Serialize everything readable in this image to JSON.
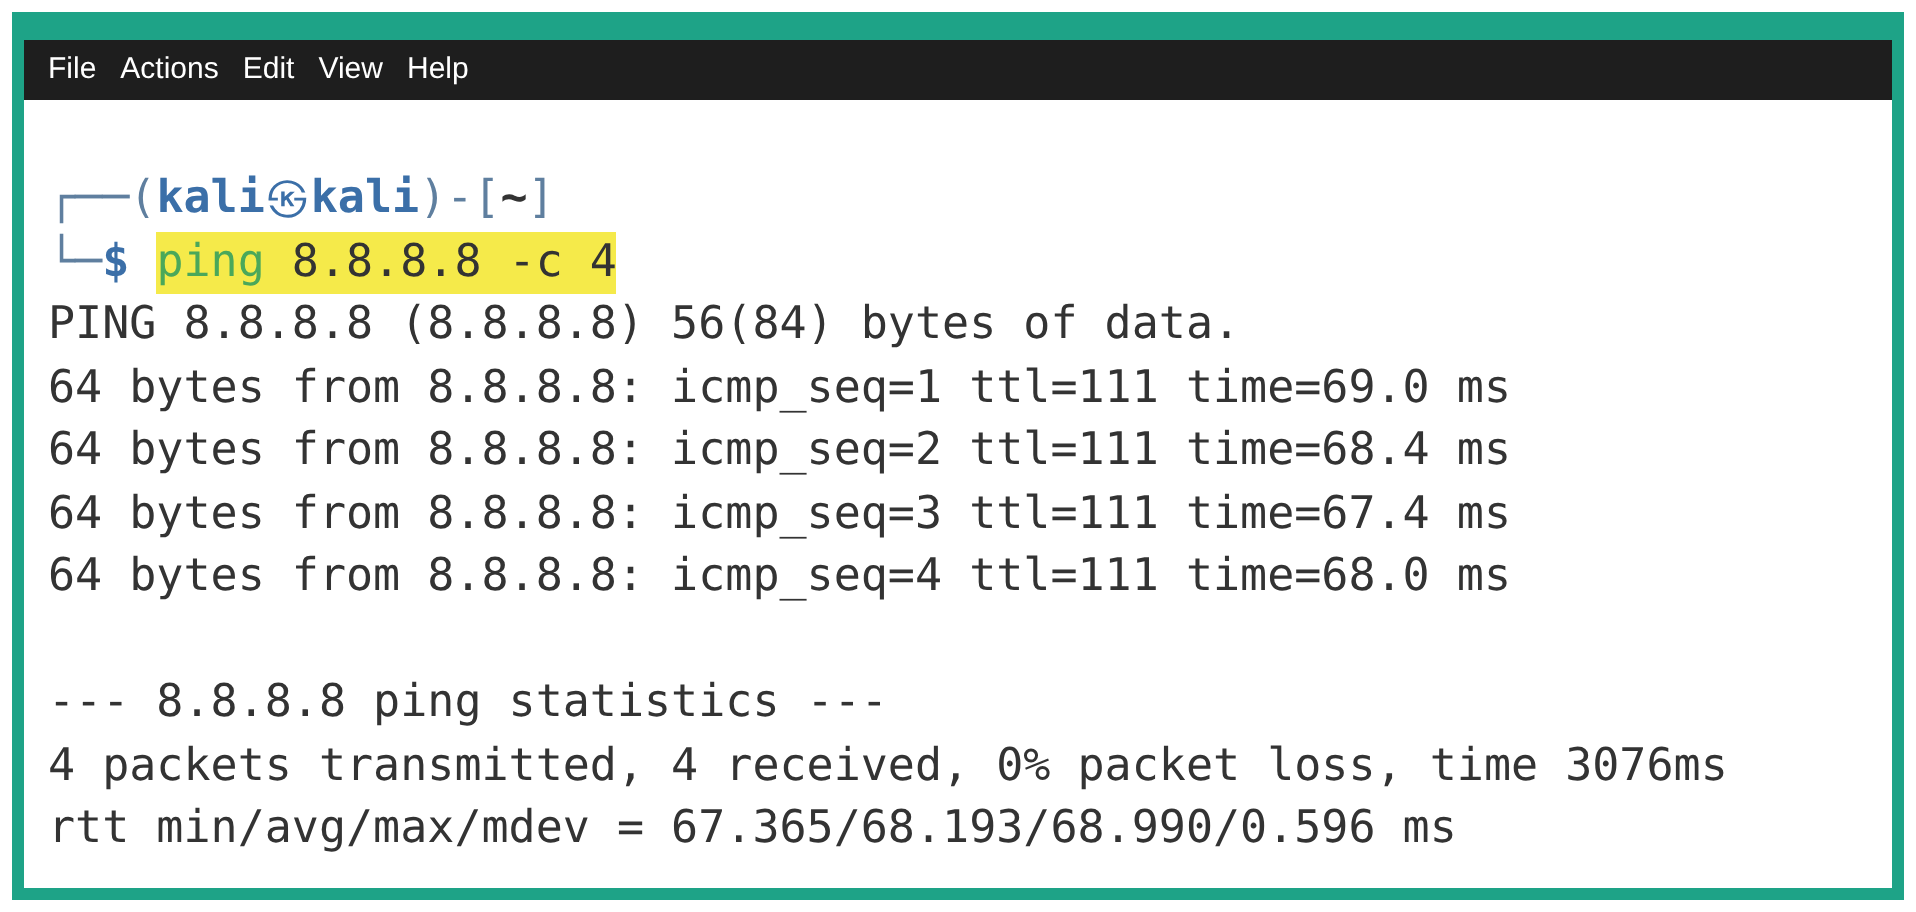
{
  "menu": [
    "File",
    "Actions",
    "Edit",
    "View",
    "Help"
  ],
  "prompt": {
    "open": "┌──(",
    "user": "kali",
    "at": "㉿",
    "host": "kali",
    "mid": ")-[",
    "path": "~",
    "close": "]",
    "corner": "└─",
    "symbol": "$"
  },
  "command": {
    "program": "ping",
    "args": "8.8.8.8 -c 4",
    "highlighted": true
  },
  "output": [
    {
      "lines": [
        "PING 8.8.8.8 (8.8.8.8) 56(84) bytes of data.",
        "64 bytes from 8.8.8.8: icmp_seq=1 ttl=111 time=69.0 ms",
        "64 bytes from 8.8.8.8: icmp_seq=2 ttl=111 time=68.4 ms",
        "64 bytes from 8.8.8.8: icmp_seq=3 ttl=111 time=67.4 ms",
        "64 bytes from 8.8.8.8: icmp_seq=4 ttl=111 time=68.0 ms"
      ]
    },
    {
      "lines": [
        "--- 8.8.8.8 ping statistics ---",
        "4 packets transmitted, 4 received, 0% packet loss, time 3076ms",
        "rtt min/avg/max/mdev = 67.365/68.193/68.990/0.596 ms"
      ]
    }
  ]
}
